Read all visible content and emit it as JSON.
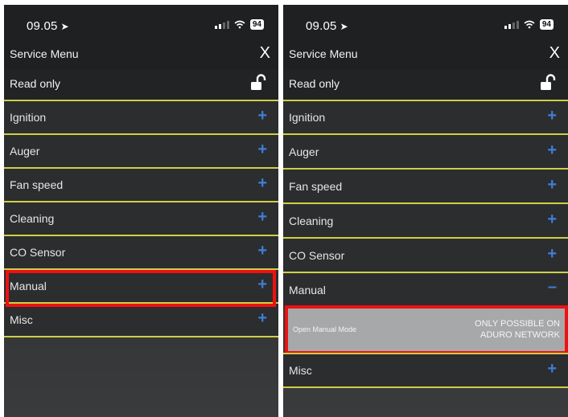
{
  "phones": [
    {
      "status": {
        "time": "09.05",
        "battery": "94"
      },
      "header": {
        "title": "Service Menu",
        "close_label": "X"
      },
      "readonly": {
        "label": "Read only"
      },
      "menu": [
        "Ignition",
        "Auger",
        "Fan speed",
        "Cleaning",
        "CO Sensor",
        "Manual",
        "Misc"
      ]
    },
    {
      "status": {
        "time": "09.05",
        "battery": "94"
      },
      "header": {
        "title": "Service Menu",
        "close_label": "X"
      },
      "readonly": {
        "label": "Read only"
      },
      "menu": [
        "Ignition",
        "Auger",
        "Fan speed",
        "Cleaning",
        "CO Sensor",
        "Manual",
        "Misc"
      ],
      "manual_submenu": {
        "label": "Open Manual Mode",
        "note_line1": "ONLY POSSIBLE ON",
        "note_line2": "ADURO NETWORK"
      }
    }
  ],
  "icons": {
    "location": "location-arrow-icon",
    "signal": "signal-icon",
    "wifi": "wifi-icon",
    "battery": "battery-icon",
    "lock": "unlocked-padlock-icon",
    "expand": "plus-icon",
    "collapse": "minus-icon",
    "close": "close-icon"
  },
  "colors": {
    "accent_divider": "#cfcf46",
    "plus_blue": "#3e7fd8",
    "highlight_red": "#ee1111",
    "background": "#2c2d2f",
    "submenu_bg": "#a7a8a9"
  },
  "highlights": [
    "Manual (left screen)",
    "Open Manual Mode (right screen)"
  ]
}
